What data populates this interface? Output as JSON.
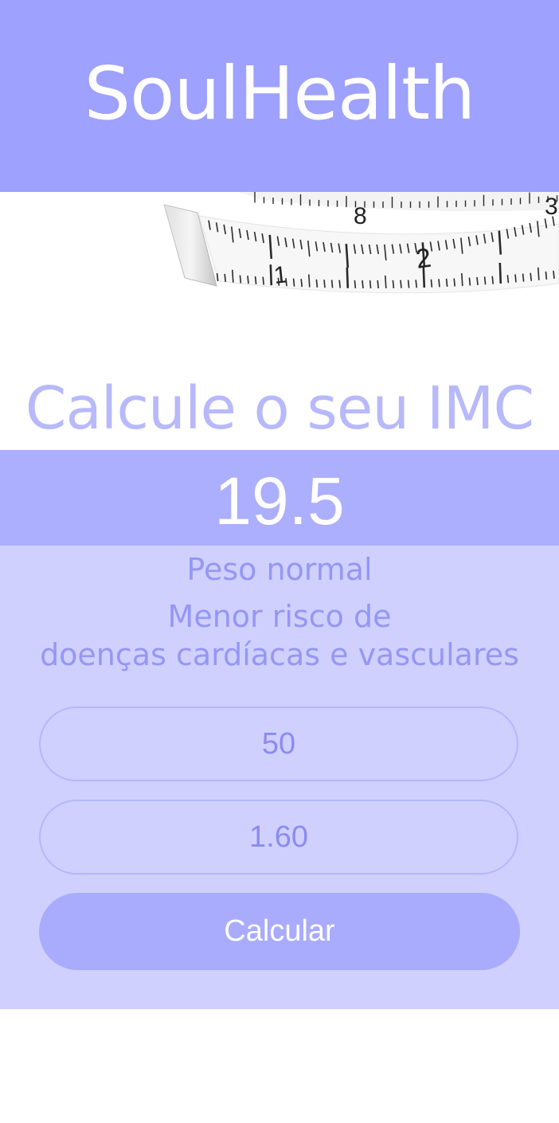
{
  "header": {
    "title": "SoulHealth"
  },
  "hero": {
    "image": "measuring-tape",
    "tape_numbers": [
      "1",
      "2",
      "8",
      "3"
    ]
  },
  "main": {
    "heading": "Calcule o seu IMC",
    "result": {
      "value": "19.5",
      "category": "Peso normal",
      "risk_line1": "Menor risco de",
      "risk_line2": "doenças cardíacas e vasculares"
    },
    "weight_input": {
      "value": "50"
    },
    "height_input": {
      "value": "1.60"
    },
    "calculate_label": "Calcular"
  },
  "colors": {
    "header_bg": "#9ea1fe",
    "result_bar_bg": "#acaefe",
    "panel_bg": "#cfd0fe",
    "button_bg": "#a9abfd",
    "heading_text": "#b8b9fb",
    "info_text": "#9597f4"
  }
}
